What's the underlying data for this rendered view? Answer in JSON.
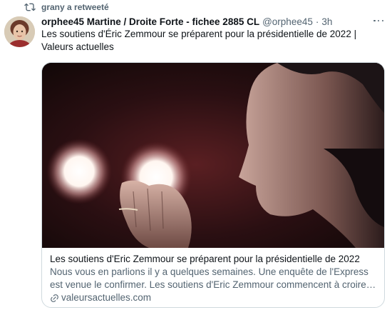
{
  "retweet": {
    "icon": "retweet-icon",
    "label": "grany a retweeté"
  },
  "tweet": {
    "avatar_icon": "avatar",
    "display_name": "orphee45 Martine / Droite Forte - fichee 2885 CL",
    "handle": "@orphee45",
    "separator": "·",
    "time": "3h",
    "more_icon": "more-options-icon",
    "text": "Les soutiens d'Éric Zemmour se préparent pour la présidentielle de 2022 | Valeurs actuelles"
  },
  "card": {
    "image_icon": "article-photo",
    "title": "Les soutiens d'Eric Zemmour se préparent pour la présidentielle de 2022",
    "description": "Nous vous en parlions il y a quelques semaines. Une enquête de l'Express est venue le confirmer. Les soutiens d'Eric Zemmour commencent à croire en un…",
    "domain_icon": "link-icon",
    "domain": "valeursactuelles.com"
  },
  "colors": {
    "text_primary": "#0f1419",
    "text_secondary": "#536471",
    "border": "#cfd9de"
  }
}
